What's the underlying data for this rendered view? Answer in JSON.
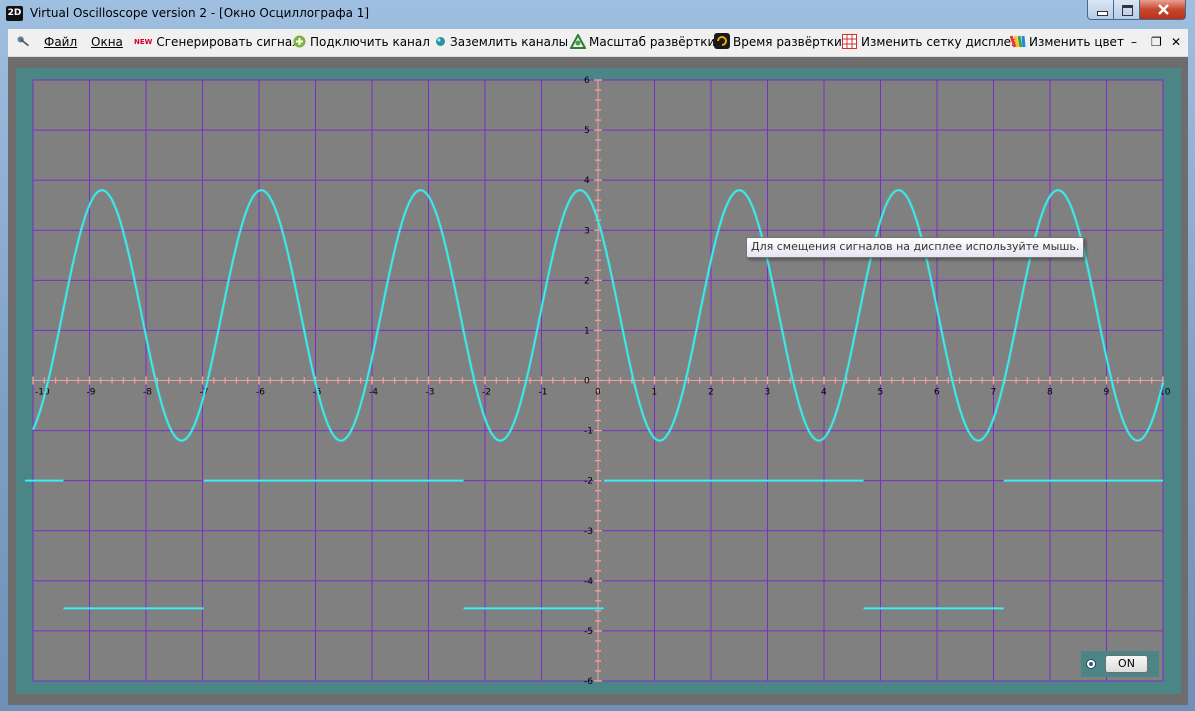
{
  "window": {
    "app_icon_label": "2D",
    "title": "Virtual Oscilloscope version 2 - [Окно Осциллографа 1]"
  },
  "menu": {
    "file": "Файл",
    "windows": "Окна",
    "generate_badge": "NEW",
    "generate": "Сгенерировать сигнал",
    "connect": "Подключить канал",
    "ground": "Заземлить каналы",
    "scale": "Масштаб развёртки",
    "sweep_time": "Время развёртки",
    "grid": "Изменить сетку дисплея",
    "color": "Изменить цвет"
  },
  "mdi_controls": {
    "minimize": "–",
    "restore": "❐",
    "close": "✕"
  },
  "tooltip": "Для смещения сигналов на дисплее используйте мышь.",
  "on_button": "ON",
  "colors": {
    "screen": "#808080",
    "grid": "#7a2ec8",
    "axis": "#f0a0a0",
    "trace": "#37f0f0",
    "frame": "#4b8585"
  },
  "chart_data": {
    "type": "line",
    "x_range": [
      -10,
      10
    ],
    "y_range": [
      -6,
      6
    ],
    "x_ticks": [
      "-10",
      "-9",
      "-8",
      "-7",
      "-6",
      "-5",
      "-4",
      "-3",
      "-2",
      "-1",
      "0",
      "1",
      "2",
      "3",
      "4",
      "5",
      "6",
      "7",
      "8",
      "9",
      "10"
    ],
    "y_ticks": [
      "6",
      "5",
      "4",
      "3",
      "2",
      "1",
      "0",
      "-1",
      "-2",
      "-3",
      "-4",
      "-5",
      "-6"
    ],
    "series": [
      {
        "kind": "sine",
        "amplitude": 2.5,
        "offset": 1.3,
        "period": 2.82,
        "peak_x": 2.5
      },
      {
        "kind": "square",
        "high": -2.0,
        "low": -4.55,
        "period": 7.08,
        "high_start_x": 0.1,
        "high_duration": 4.6,
        "x_start": -10.2
      }
    ]
  }
}
